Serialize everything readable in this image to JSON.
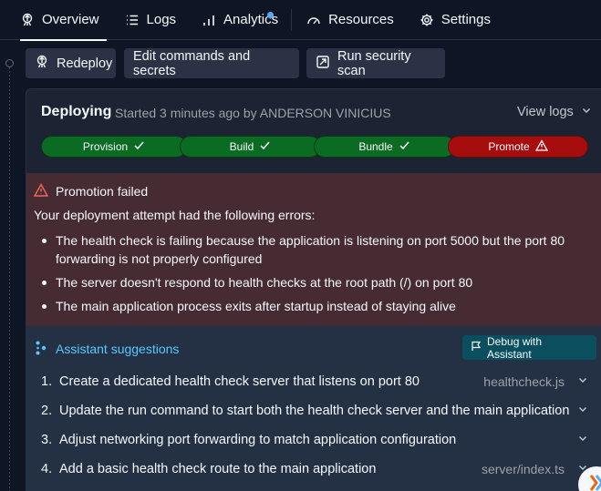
{
  "tabs": [
    {
      "label": "Overview",
      "icon": "deploy-rocket-icon",
      "active": true
    },
    {
      "label": "Logs",
      "icon": "list-icon",
      "active": false
    },
    {
      "label": "Analytics",
      "icon": "bar-chart-icon",
      "active": false,
      "badge_color": "#57abff"
    },
    {
      "label": "Resources",
      "icon": "gauge-icon",
      "active": false
    },
    {
      "label": "Settings",
      "icon": "gear-icon",
      "active": false
    }
  ],
  "actions": {
    "redeploy": "Redeploy",
    "edit": "Edit commands and secrets",
    "scan": "Run security scan"
  },
  "deployment": {
    "status": "Deploying",
    "subtitle": "Started 3 minutes ago by ANDERSON VINICIUS",
    "view_logs": "View logs"
  },
  "stages": [
    {
      "label": "Provision",
      "state": "success",
      "color": "#0b6b22"
    },
    {
      "label": "Build",
      "state": "success",
      "color": "#0b6b22"
    },
    {
      "label": "Bundle",
      "state": "success",
      "color": "#0b6b22"
    },
    {
      "label": "Promote",
      "state": "failed",
      "color": "#a60d0d"
    }
  ],
  "error": {
    "title": "Promotion failed",
    "intro": "Your deployment attempt had the following errors:",
    "items": [
      "The health check is failing because the application is listening on port 5000 but the port 80 forwarding is not properly configured",
      "The server doesn't respond to health checks at the root path (/) on port 80",
      "The main application process exits after startup instead of staying alive"
    ]
  },
  "assistant": {
    "title": "Assistant suggestions",
    "debug_button": "Debug with Assistant",
    "suggestions": [
      {
        "num": "1.",
        "text": "Create a dedicated health check server that listens on port 80",
        "file": "healthcheck.js"
      },
      {
        "num": "2.",
        "text": "Update the run command to start both the health check server and the main application",
        "file": ""
      },
      {
        "num": "3.",
        "text": "Adjust networking port forwarding to match application configuration",
        "file": ""
      },
      {
        "num": "4.",
        "text": "Add a basic health check route to the main application",
        "file": "server/index.ts"
      }
    ]
  },
  "colors": {
    "background": "#0e1525",
    "card": "#1c2333",
    "error_bg": "#472b33",
    "assistant_accent": "#57c9ff"
  }
}
